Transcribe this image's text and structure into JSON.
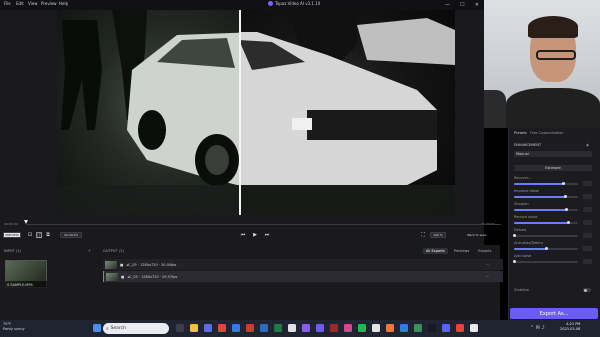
{
  "titlebar": {
    "menus": [
      "File",
      "Edit",
      "View",
      "Preview",
      "Help"
    ],
    "title": "Topaz Video AI v3.1.10",
    "controls": [
      "—",
      "☐",
      "✕"
    ]
  },
  "timeline": {
    "start_time": "00:00:00",
    "end_time": "00:00:09",
    "preview_button": "PREVIEW",
    "duration_box": "00:00:03",
    "zoom_value": "100 %",
    "back_button": "Back to view"
  },
  "input_panel": {
    "label": "INPUT (1)",
    "file_name": "0.SAMPLE.MP4"
  },
  "output_panel": {
    "label": "OUTPUT (2)",
    "tabs": [
      "All Exports",
      "Previews",
      "Exports"
    ],
    "rows": [
      {
        "badge": "■",
        "text": "◂C_05 · 1280x720 · 30.00fps"
      },
      {
        "badge": "■",
        "text": "◂C_05 · 1280x720 · 29.97fps"
      }
    ]
  },
  "right_panel": {
    "tabs": [
      "Presets",
      "Free Customization"
    ],
    "section": "ENHANCEMENT",
    "dropdown_value": "Manual",
    "estimate_button": "Estimate",
    "settings": [
      {
        "label": "Recover...",
        "value": 0.78
      },
      {
        "label": "Improve detail",
        "value": 0.8
      },
      {
        "label": "Sharpen",
        "value": 0.82
      },
      {
        "label": "Reduce noise",
        "value": 0.85
      },
      {
        "label": "Dehalo",
        "value": 0.0
      },
      {
        "label": "Anti-alias/Deblur",
        "value": 0.5
      },
      {
        "label": "Add noise",
        "value": 0.0
      }
    ],
    "stabilize_label": "Stabilize",
    "export_button": "Export As..."
  },
  "taskbar": {
    "weather_temp": "70°F",
    "weather_desc": "Partly sunny",
    "search_placeholder": "Search",
    "time": "4:21 PM",
    "date": "2023-03-08"
  },
  "colors": {
    "accent": "#6b5cf6",
    "slider_fill": "#6b7cff",
    "selection": "#4f8ff0"
  }
}
